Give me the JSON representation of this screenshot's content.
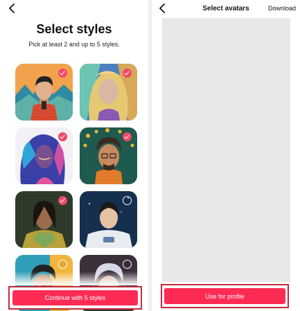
{
  "left": {
    "title": "Select styles",
    "subtitle": "Pick at least 2 and up to 5 styles.",
    "styles": [
      {
        "name": "geometric-portrait",
        "selected": true
      },
      {
        "name": "psychedelic-portrait",
        "selected": true
      },
      {
        "name": "watercolor-portrait",
        "selected": true
      },
      {
        "name": "retro-pop-portrait",
        "selected": true
      },
      {
        "name": "armor-portrait",
        "selected": true
      },
      {
        "name": "astronaut-portrait",
        "selected": false
      },
      {
        "name": "comic-portrait",
        "selected": false
      },
      {
        "name": "cyber-portrait",
        "selected": false
      }
    ],
    "continue_label": "Continue with 5 styles"
  },
  "right": {
    "title": "Select avatars",
    "download_label": "Download",
    "use_label": "Use for profile"
  },
  "colors": {
    "accent": "#fe2c55",
    "check": "#ef4a64",
    "highlight_border": "#c42a3c",
    "preview_bg": "#e8e8e8"
  }
}
